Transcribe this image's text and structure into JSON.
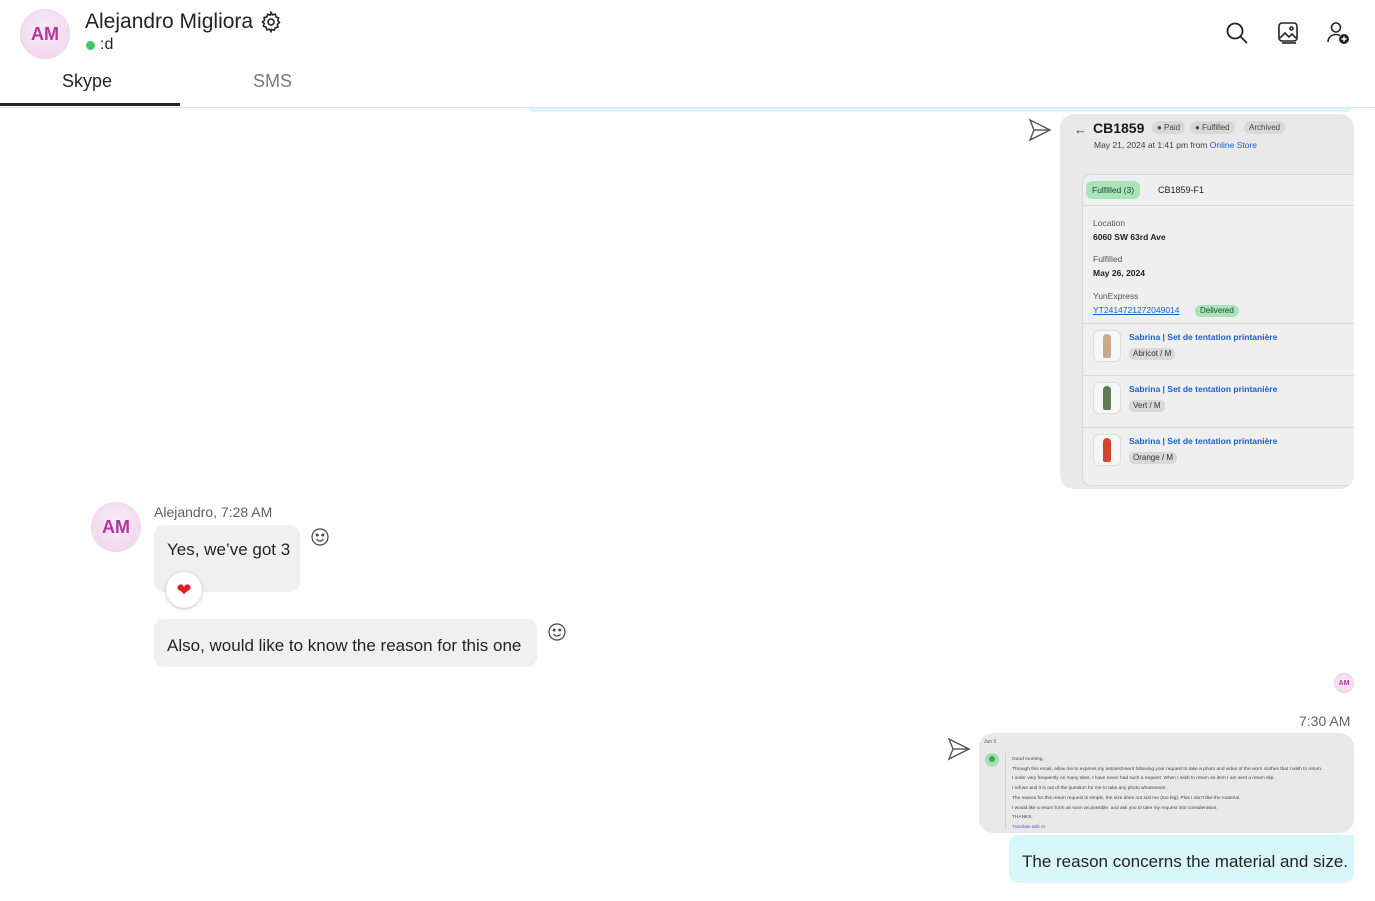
{
  "header": {
    "avatar_initials": "AM",
    "contact_name": "Alejandro Migliora",
    "status_text": ":d",
    "status_color": "#3fc965",
    "actions": [
      "search-icon",
      "gallery-icon",
      "add-person-icon"
    ]
  },
  "tabs": [
    {
      "label": "Skype",
      "active": true
    },
    {
      "label": "SMS",
      "active": false
    }
  ],
  "order_card": {
    "back_arrow": "←",
    "order_number": "CB1859",
    "badges": [
      "● Paid",
      "● Fulfilled",
      "Archived"
    ],
    "date_prefix": "May 21, 2024 at 1:41 pm from ",
    "date_source": "Online Store",
    "fulfilled_badge": "Fulfilled (3)",
    "fulfillment_id": "CB1859-F1",
    "location_label": "Location",
    "location_value": "6060 SW 63rd Ave",
    "fulfilled_label": "Fulfilled",
    "fulfilled_value": "May 26, 2024",
    "carrier_label": "YunExpress",
    "tracking_number": "YT2414721272049014",
    "tracking_status": "Delivered",
    "items": [
      {
        "name": "Sabrina | Set de tentation printanière",
        "variant": "Abricot / M",
        "swatch": "#c9a98a"
      },
      {
        "name": "Sabrina | Set de tentation printanière",
        "variant": "Vert / M",
        "swatch": "#5e7d55"
      },
      {
        "name": "Sabrina | Set de tentation printanière",
        "variant": "Orange / M",
        "swatch": "#d2452b"
      }
    ]
  },
  "incoming": {
    "avatar_initials": "AM",
    "sender_time": "Alejandro, 7:28 AM",
    "message_1": "Yes, we’ve got 3",
    "reaction": "❤",
    "message_2": "Also, would like to know the reason for this one"
  },
  "read_receipt_initials": "AM",
  "outgoing": {
    "time": "7:30 AM",
    "email": {
      "date": "Jun 5",
      "lines": [
        "Good morning,",
        "Through this email, allow me to express my astonishment following your request to take a photo and video of the worn clothes that I wish to return.",
        "I order very frequently on many sites, I have never had such a request. When I wish to return an item I am sent a return slip.",
        "I refuse and it is out of the question for me to take any photo whatsoever.",
        "The reason for this return request is simple, the size does not suit me (too big). Plus I don't like the material.",
        "I would like a return form as soon as possible, and ask you to take my request into consideration.",
        "THANKS."
      ],
      "translate_label": "Translate with AI"
    },
    "message": "The reason concerns the material and size."
  }
}
